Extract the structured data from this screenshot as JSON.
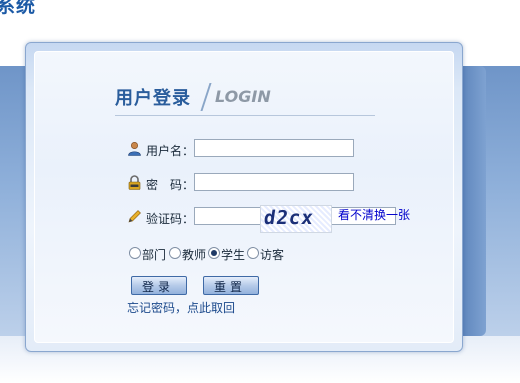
{
  "header": {
    "system_title": "系统"
  },
  "login": {
    "title_cn": "用户登录",
    "title_en": "LOGIN",
    "username_label": "用户名：",
    "username_value": "",
    "password_label": "密　码：",
    "password_value": "",
    "captcha_label": "验证码：",
    "captcha_value": "",
    "captcha_image_text": "d2cx",
    "captcha_refresh": "看不清换一张",
    "roles": [
      {
        "label": "部门",
        "checked": false
      },
      {
        "label": "教师",
        "checked": false
      },
      {
        "label": "学生",
        "checked": true
      },
      {
        "label": "访客",
        "checked": false
      }
    ],
    "login_button": "登录",
    "reset_button": "重置",
    "forgot_link": "忘记密码，点此取回"
  },
  "colors": {
    "accent": "#2a5d9c",
    "link": "#0000cc",
    "band": "#7fa3d3"
  },
  "icons": [
    "user-icon",
    "lock-icon",
    "pencil-icon"
  ]
}
